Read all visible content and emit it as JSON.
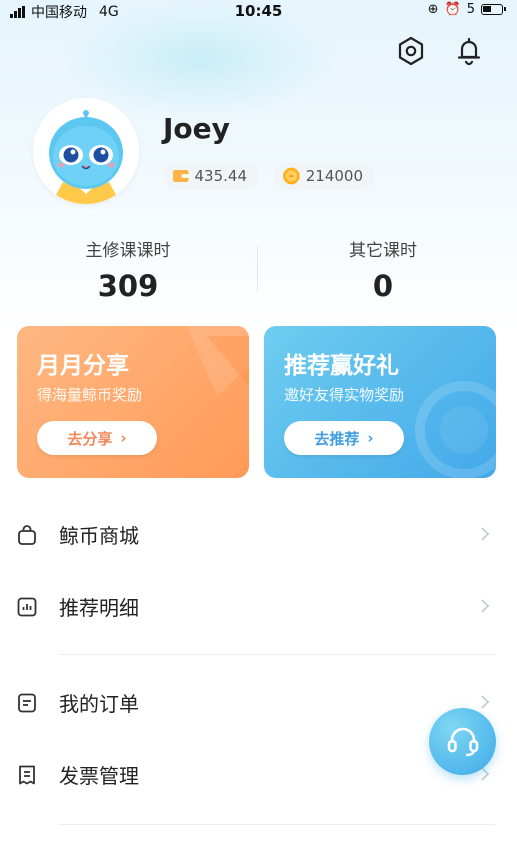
{
  "status_bar": {
    "carrier": "中国移动",
    "network": "4G",
    "time": "10:45",
    "battery": "5"
  },
  "header": {
    "settings_icon": "settings-hexagon-icon",
    "notification_icon": "bell-icon"
  },
  "profile": {
    "username": "Joey",
    "wallet_balance": "435.44",
    "coin_balance": "214000",
    "avatar": "blue-whale-mascot"
  },
  "stats": {
    "main_label": "主修课课时",
    "main_value": "309",
    "other_label": "其它课时",
    "other_value": "0"
  },
  "promos": {
    "share": {
      "title": "月月分享",
      "subtitle": "得海量鲸币奖励",
      "button": "去分享",
      "color": "#ff9a58"
    },
    "refer": {
      "title": "推荐赢好礼",
      "subtitle": "邀好友得实物奖励",
      "button": "去推荐",
      "color": "#42a8ea"
    }
  },
  "menu": {
    "items": [
      {
        "label": "鲸币商城",
        "icon": "shopping-bag-icon"
      },
      {
        "label": "推荐明细",
        "icon": "bar-chart-icon"
      },
      {
        "label": "我的订单",
        "icon": "order-icon"
      },
      {
        "label": "发票管理",
        "icon": "invoice-icon"
      }
    ]
  },
  "customer_service": {
    "icon": "headset-icon",
    "color": "#3da9e8"
  }
}
